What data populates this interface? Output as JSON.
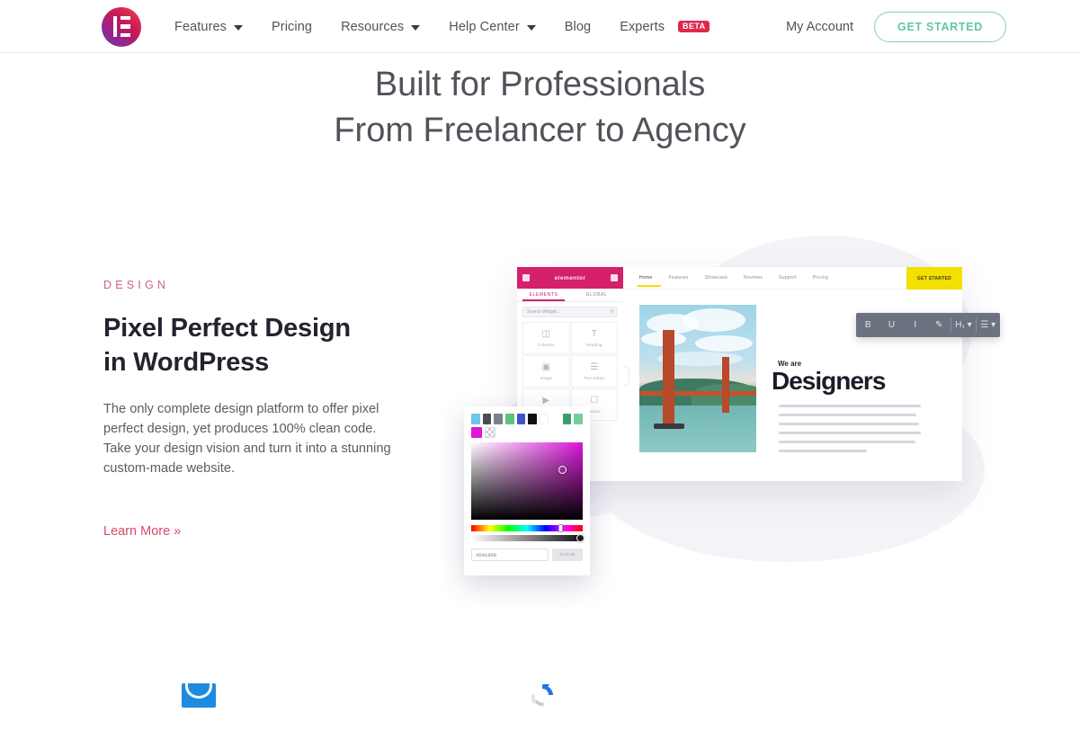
{
  "navbar": {
    "logo_name": "elementor-logo",
    "links": [
      {
        "label": "Features",
        "has_dropdown": true
      },
      {
        "label": "Pricing",
        "has_dropdown": false
      },
      {
        "label": "Resources",
        "has_dropdown": true
      },
      {
        "label": "Help Center",
        "has_dropdown": true
      },
      {
        "label": "Blog",
        "has_dropdown": false
      },
      {
        "label": "Experts",
        "has_dropdown": false,
        "badge": "BETA"
      }
    ],
    "my_account": "My Account",
    "cta": "GET STARTED",
    "cta_color": "#62c79c"
  },
  "hero": {
    "line1": "Built for Professionals",
    "line2": "From Freelancer to Agency"
  },
  "feature": {
    "eyebrow": "DESIGN",
    "eyebrow_color": "#d4607c",
    "title": "Pixel Perfect Design\nin WordPress",
    "body": "The only complete design platform to offer pixel\nperfect design, yet produces 100% clean code.\nTake your design vision and turn it into a stunning\ncustom-made website.",
    "link": "Learn More »",
    "link_color": "#d6496b"
  },
  "mockup": {
    "editor": {
      "header_title": "elementor",
      "header_color": "#d5206b",
      "tabs": [
        {
          "label": "ELEMENTS",
          "active": true
        },
        {
          "label": "GLOBAL",
          "active": false
        }
      ],
      "search_placeholder": "Search Widget...",
      "search_icon": "search-icon",
      "widgets": [
        {
          "label": "Columns",
          "icon": "columns-icon"
        },
        {
          "label": "Heading",
          "icon": "heading-icon"
        },
        {
          "label": "Image",
          "icon": "image-icon"
        },
        {
          "label": "Text Editor",
          "icon": "text-editor-icon"
        },
        {
          "label": "Video",
          "icon": "video-icon"
        },
        {
          "label": "Button",
          "icon": "button-icon"
        }
      ]
    },
    "site": {
      "nav_items": [
        "Home",
        "Features",
        "Showcase",
        "Reviews",
        "Support",
        "Pricing"
      ],
      "nav_active": "Home",
      "cta": "GET STARTED",
      "cta_bg": "#f3e000",
      "image_alt": "golden-gate-bridge-photo",
      "eyebrow": "We are",
      "headline": "Designers",
      "paragraph_lines": 6
    },
    "rich_text_toolbar": {
      "buttons": [
        "B",
        "U",
        "I",
        "✎",
        "H₁ ▾",
        "☰ ▾"
      ],
      "bg": "#6b7280"
    },
    "color_picker": {
      "swatches_row1": [
        "#6ec6e8",
        "#4d4d55",
        "#808089",
        "#5bc47c",
        "#3f55c9",
        "#111115",
        "#ffffff",
        "",
        "#3d9e6d",
        "#72cf98"
      ],
      "swatches_row2": [
        "#d916d9",
        "transparent"
      ],
      "selected_hex": "#D916D9",
      "clear_button": "CLEAR",
      "saturation_color": "#d916d9"
    }
  },
  "bottom_icons": [
    {
      "name": "mail-icon",
      "color": "#1d8ce0"
    },
    {
      "name": "recaptcha-icon",
      "color": "#1c6ee0"
    }
  ]
}
